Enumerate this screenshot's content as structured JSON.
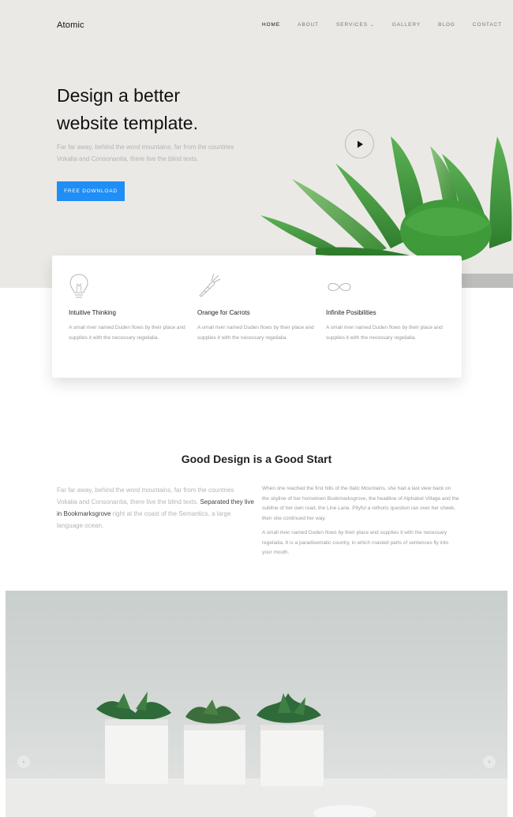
{
  "brand": "Atomic",
  "nav": [
    {
      "label": "HOME",
      "active": true
    },
    {
      "label": "ABOUT"
    },
    {
      "label": "SERVICES",
      "dropdown": true
    },
    {
      "label": "GALLERY"
    },
    {
      "label": "BLOG"
    },
    {
      "label": "CONTACT"
    }
  ],
  "hero": {
    "title_line1": "Design a better",
    "title_line2": "website template.",
    "subtitle": "Far far away, behind the word mountains, far from the countries Vokalia and Consonantia, there live the blind texts.",
    "button": "FREE DOWNLOAD"
  },
  "features": [
    {
      "icon": "lightbulb-icon",
      "title": "Intuitive Thinking",
      "text": "A small river named Duden flows by their place and supplies it with the necessary regelialia."
    },
    {
      "icon": "carrot-icon",
      "title": "Orange for Carrots",
      "text": "A small river named Duden flows by their place and supplies it with the necessary regelialia."
    },
    {
      "icon": "infinity-icon",
      "title": "Infinite Posibilities",
      "text": "A small river named Duden flows by their place and supplies it with the necessary regelialia."
    }
  ],
  "good": {
    "title": "Good Design is a Good Start",
    "left_text_1": "Far far away, behind the word mountains, far from the countries Vokalia and Consonantia, there live the blind texts.",
    "left_text_dark": "Separated they live in Bookmarksgrove",
    "left_text_2": "right at the coast of the Semantics, a large language ocean.",
    "right_p1": "When she reached the first hills of the Italic Mountains, she had a last view back on the skyline of her hometown Bookmarksgrove, the headline of Alphabet Village and the subline of her own road, the Line Lane. Pityful a rethoric question ran over her cheek, then she continued her way.",
    "right_p2": "A small river named Duden flows by their place and supplies it with the necessary regelialia. It is a paradisematic country, in which roasted parts of sentences fly into your mouth."
  },
  "colors": {
    "accent": "#1f8ef7",
    "hero_bg": "#ebe9e6",
    "leaf": "#3f9a3a"
  }
}
